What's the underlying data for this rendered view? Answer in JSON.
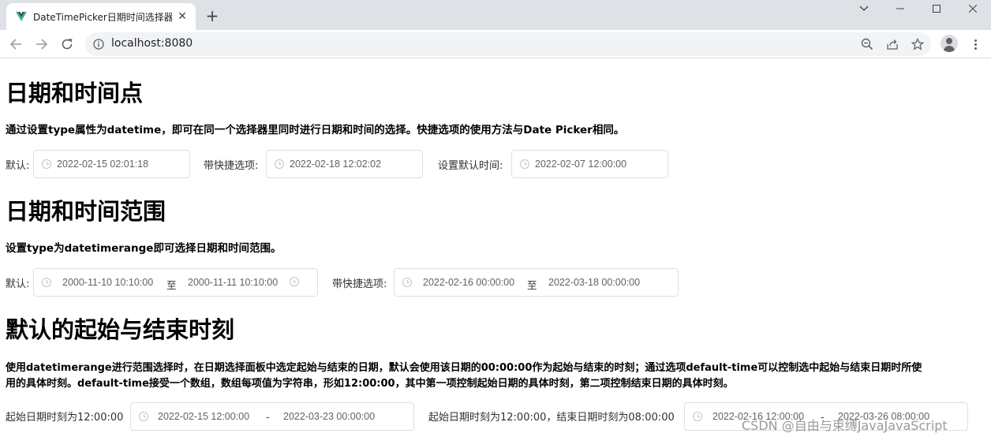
{
  "browser": {
    "tab_title": "DateTimePicker日期时间选择器",
    "url": "localhost:8080"
  },
  "sections": [
    {
      "title": "日期和时间点",
      "description": "通过设置type属性为datetime，即可在同一个选择器里同时进行日期和时间的选择。快捷选项的使用方法与Date Picker相同。",
      "pickers": [
        {
          "label": "默认:",
          "value": "2022-02-15 02:01:18"
        },
        {
          "label": "带快捷选项:",
          "value": "2022-02-18 12:02:02"
        },
        {
          "label": "设置默认时间:",
          "value": "2022-02-07 12:00:00"
        }
      ]
    },
    {
      "title": "日期和时间范围",
      "description": "设置type为datetimerange即可选择日期和时间范围。",
      "pickers": [
        {
          "label": "默认:",
          "start": "2000-11-10 10:10:00",
          "separator": "至",
          "end": "2000-11-11 10:10:00"
        },
        {
          "label": "带快捷选项:",
          "start": "2022-02-16 00:00:00",
          "separator": "至",
          "end": "2022-03-18 00:00:00"
        }
      ]
    },
    {
      "title": "默认的起始与结束时刻",
      "description_line1": "使用datetimerange进行范围选择时，在日期选择面板中选定起始与结束的日期，默认会使用该日期的00:00:00作为起始与结束的时刻；通过选项default-time可以控制选中起始与结束日期时所使",
      "description_line2": "用的具体时刻。default-time接受一个数组，数组每项值为字符串，形如12:00:00，其中第一项控制起始日期的具体时刻，第二项控制结束日期的具体时刻。",
      "pickers": [
        {
          "label": "起始日期时刻为12:00:00",
          "start": "2022-02-15 12:00:00",
          "separator": "-",
          "end": "2022-03-23 00:00:00"
        },
        {
          "label": "起始日期时刻为12:00:00，结束日期时刻为08:00:00",
          "start": "2022-02-16 12:00:00",
          "separator": "-",
          "end": "2022-03-26 08:00:00"
        }
      ]
    }
  ],
  "watermark": "CSDN @自由与束缚JavaJavaScript"
}
